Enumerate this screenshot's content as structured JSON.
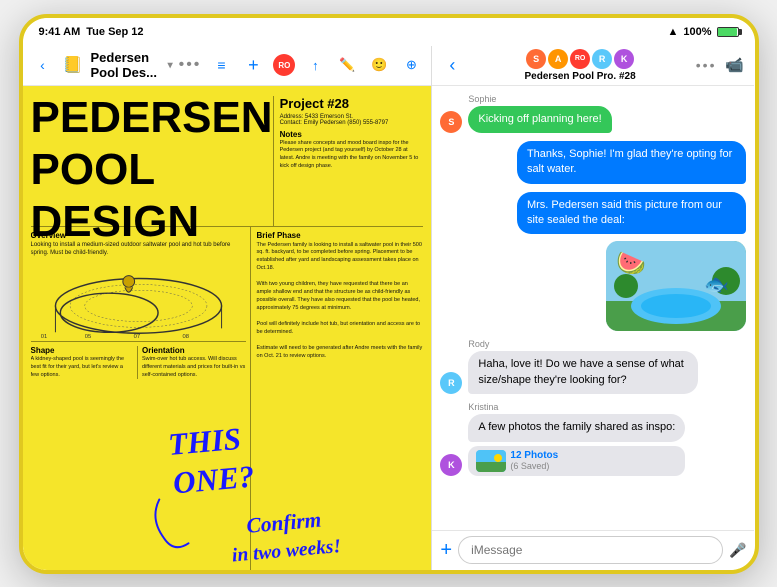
{
  "device": {
    "time": "9:41 AM",
    "date": "Tue Sep 12",
    "battery": "100%",
    "wifi": true
  },
  "notes": {
    "toolbar": {
      "back_icon": "‹",
      "book_icon": "📖",
      "title": "Pedersen Pool Des...",
      "chevron": "⌄",
      "list_icon": "≡",
      "add_icon": "+",
      "ro_badge": "RO",
      "share_icon": "↑",
      "markup_icon": "✏",
      "emoji_icon": "☺",
      "more_icon": "⊕"
    },
    "big_title_line1": "PEDERSEN",
    "big_title_line2": "POOL",
    "big_title_line3": "DESIGN",
    "project_number": "Project #28",
    "project_address": "Address: 5433 Emerson St.",
    "project_contact": "Contact: Emily Pedersen (850) 555-8797",
    "notes_label": "Notes",
    "notes_text": "Please share concepts and mood board inspo for the Pedersen project (and tag yourself) by October 28 at latest. Andre is meeting with the family on November 5 to kick off design phase.",
    "overview_label": "Overview",
    "overview_text": "Looking to install a medium-sized outdoor saltwater pool and hot tub before spring. Must be child-friendly.",
    "brief_label": "Brief Phase",
    "brief_text": "The Pedersen family is looking to install a saltwater pool in their 500 sq. ft. backyard, to be completed before spring. Placement to be established after yard and landscaping assessment takes place on Oct.18.\n\nWith two young children, they have requested that there be an ample shallow end and that the structure be as child-friendly as possible overall. They have also requested that the pool be heated, approximately 75 degrees at minimum.\n\nPool will definitely include hot tub, but orientation and access are to be determined.\n\nEstimate will need to be generated after Andre meets with the family on Oct. 21 to review options.",
    "shape_label": "Shape",
    "shape_text": "A kidney-shaped pool is seemingly the best fit for their yard, but let's review a few options.",
    "orientation_label": "Orientation",
    "orientation_text": "Swim-over hot tub access. Will discuss different materials and prices for built-in vs self-contained options.",
    "handwriting": "THIS ONE? Confirm in two weeks!"
  },
  "messages": {
    "toolbar": {
      "back_icon": "‹",
      "dots": "•••",
      "video_icon": "📹"
    },
    "thread_title": "Pedersen Pool Pro. #28",
    "messages": [
      {
        "id": 1,
        "sender": "Sophie",
        "type": "incoming",
        "text": "Kicking off planning here!",
        "avatar_color": "#FF6B35",
        "avatar_initial": "S"
      },
      {
        "id": 2,
        "sender": "me",
        "type": "outgoing",
        "text": "Thanks, Sophie! I'm glad they're opting for salt water.",
        "bubble_type": "blue"
      },
      {
        "id": 3,
        "sender": "me",
        "type": "outgoing",
        "text": "Mrs. Pedersen said this picture from our site sealed the deal:",
        "bubble_type": "blue",
        "has_image": true
      },
      {
        "id": 4,
        "sender": "Rody",
        "type": "incoming",
        "text": "Haha, love it! Do we have a sense of what size/shape they're looking for?",
        "avatar_color": "#5AC8FA",
        "avatar_initial": "R"
      },
      {
        "id": 5,
        "sender": "Kristina",
        "type": "incoming",
        "text": "A few photos the family shared as inspo:",
        "avatar_color": "#AF52DE",
        "avatar_initial": "K",
        "has_photos": true,
        "photos_label": "12 Photos",
        "photos_saved": "(6 Saved)"
      }
    ],
    "input_placeholder": "iMessage",
    "add_icon": "+",
    "mic_icon": "🎤"
  },
  "group_avatars": [
    {
      "color": "#FF6B35",
      "initial": "S"
    },
    {
      "color": "#FF9500",
      "initial": "A"
    },
    {
      "color": "#007AFF",
      "initial": "RO"
    },
    {
      "color": "#5AC8FA",
      "initial": "R"
    },
    {
      "color": "#4CD964",
      "initial": "K"
    }
  ]
}
